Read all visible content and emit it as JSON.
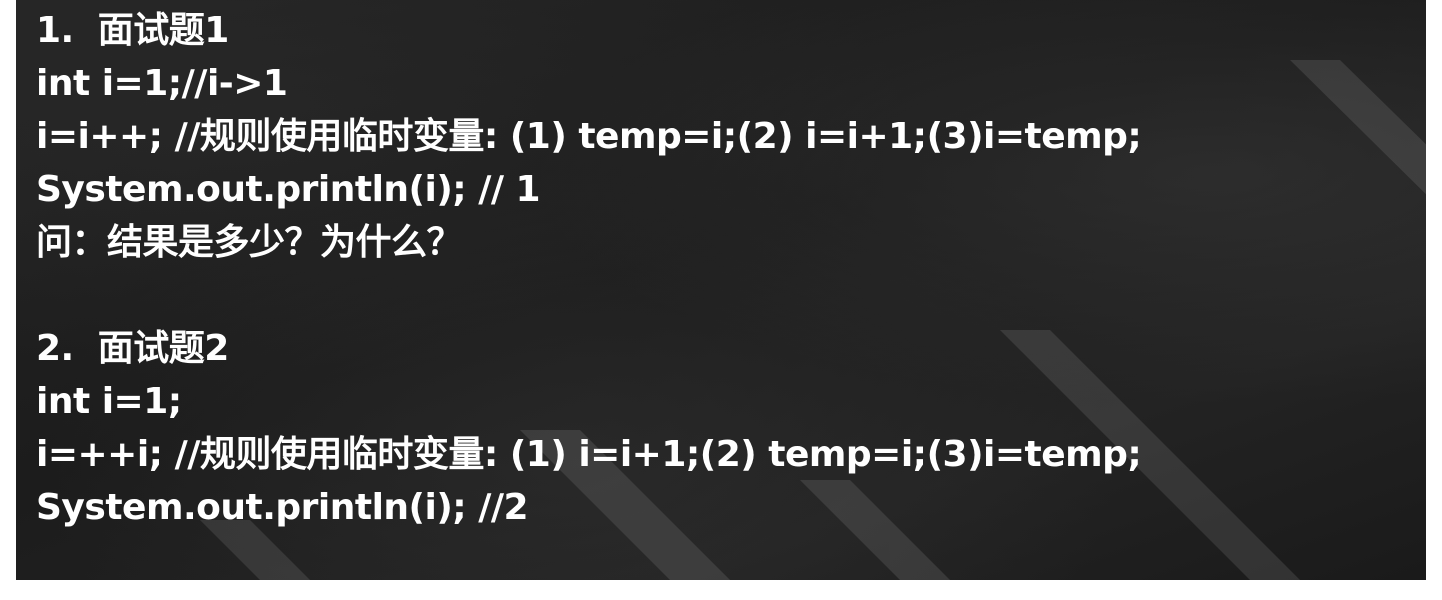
{
  "lines": [
    "1.  面试题1",
    "int i=1;//i->1",
    "i=i++; //规则使用临时变量: (1) temp=i;(2) i=i+1;(3)i=temp;",
    "System.out.println(i); // 1",
    "问：结果是多少？为什么？",
    "",
    "2.  面试题2",
    "int i=1;",
    "i=++i; //规则使用临时变量: (1) i=i+1;(2) temp=i;(3)i=temp;",
    "System.out.println(i); //2"
  ]
}
